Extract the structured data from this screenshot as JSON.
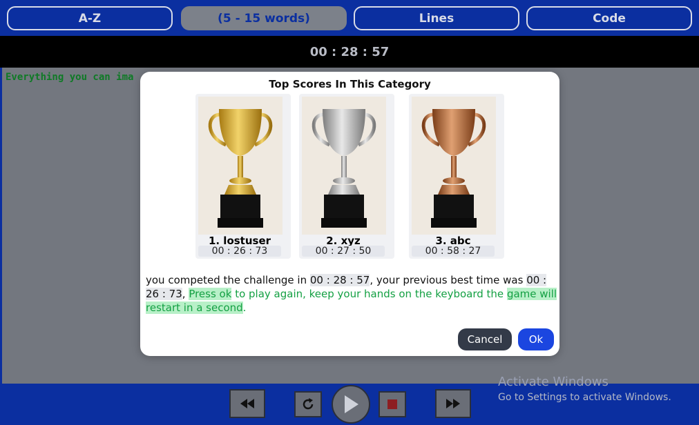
{
  "tabs": [
    {
      "label": "A-Z"
    },
    {
      "label": "(5 - 15 words)"
    },
    {
      "label": "Lines"
    },
    {
      "label": "Code"
    }
  ],
  "timer": "00 : 28 : 57",
  "typing_text": "Everything you can ima",
  "modal": {
    "title": "Top Scores In This Category",
    "scores": [
      {
        "name": "1. lostuser",
        "time": "00 : 26 : 73",
        "trophy": "gold-trophy"
      },
      {
        "name": "2. xyz",
        "time": "00 : 27 : 50",
        "trophy": "silver-trophy"
      },
      {
        "name": "3. abc",
        "time": "00 : 58 : 27",
        "trophy": "bronze-trophy"
      }
    ],
    "message": {
      "part1": "you competed the challenge in ",
      "current_time": "00 : 28 : 57",
      "part2": ", your previous best time was ",
      "best_time": "00 : 26 : 73",
      "part3": ", ",
      "press_ok": "Press ok",
      "part4": " to play again, keep your hands on the keyboard the ",
      "restart": "game will restart in a second",
      "part5": "."
    },
    "cancel_label": "Cancel",
    "ok_label": "Ok"
  },
  "controls": [
    "rewind-icon",
    "restart-icon",
    "play-icon",
    "stop-icon",
    "fast-forward-icon"
  ],
  "watermark": {
    "title": "Activate Windows",
    "subtitle": "Go to Settings to activate Windows."
  },
  "colors": {
    "primary": "#0b2fa0",
    "ok_button": "#1b46e0",
    "success_text": "#14a043",
    "gold": "#d4a72c",
    "silver": "#bdbdbd",
    "bronze": "#b06a3a"
  }
}
